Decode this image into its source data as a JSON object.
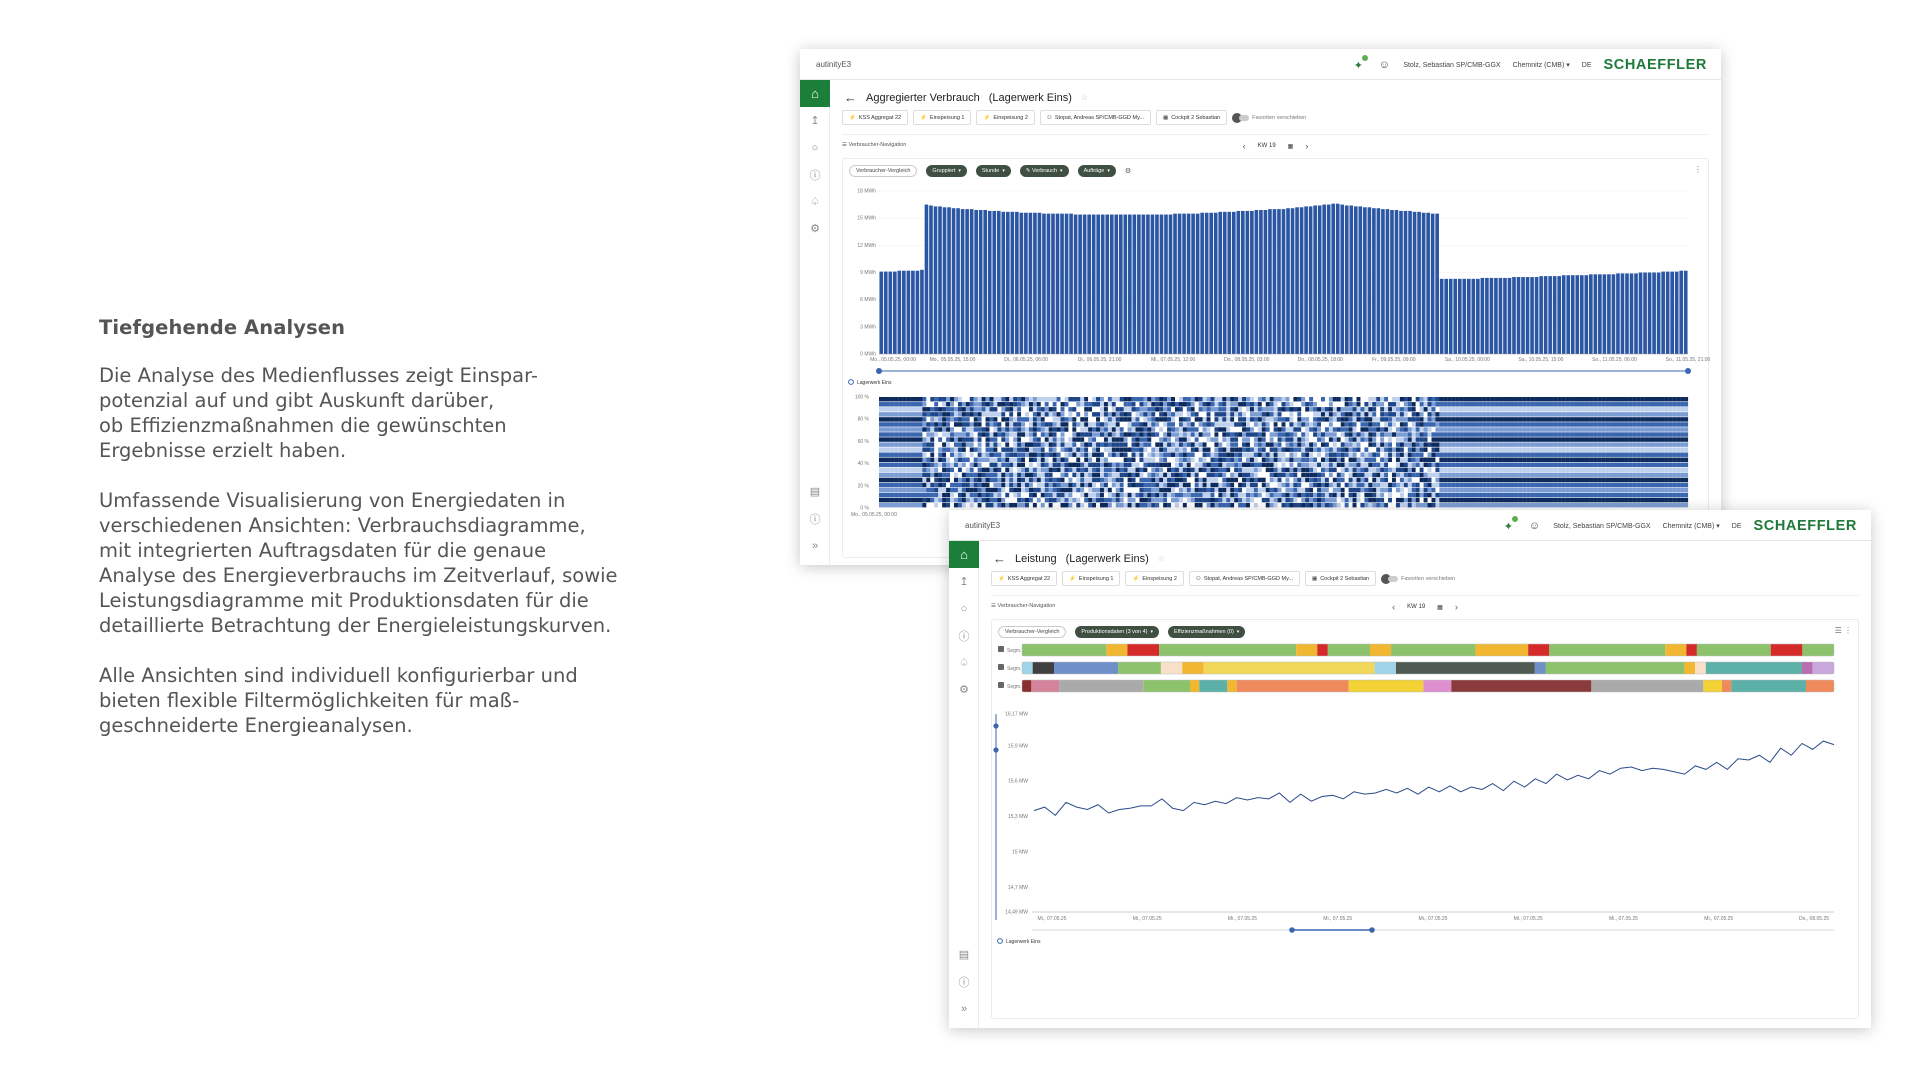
{
  "intro": {
    "heading": "Tiefgehende Analysen",
    "paragraph_1": "Die Analyse des Medienflusses zeigt Einspar-\npotenzial auf und gibt Auskunft darüber,\nob Effizienzmaßnahmen die gewünschten\nErgebnisse erzielt haben.",
    "paragraph_2": "Umfassende Visualisierung von Energiedaten in\nverschiedenen Ansichten: Verbrauchsdiagramme,\nmit integrierten Auftragsdaten für die genaue\nAnalyse des Energieverbrauchs im Zeitverlauf, sowie\nLeistungsdiagramme mit Produktionsdaten für die\ndetaillierte Betrachtung der Energieleistungskurven.",
    "paragraph_3": "Alle Ansichten sind individuell konfigurierbar und\nbieten flexible Filtermöglichkeiten für maß-\ngeschneiderte Energieanalysen."
  },
  "app": {
    "name": "autinityE3",
    "user": "Stolz, Sebastian SP/CMB-GGX",
    "site": "Chemnitz (CMB)",
    "language": "DE",
    "brand": "SCHAEFFLER",
    "brand_color": "#1f7a3a",
    "favorites": [
      {
        "icon": "bolt-icon",
        "label": "KSS Aggregat 22"
      },
      {
        "icon": "bolt-icon",
        "label": "Einspeisung 1"
      },
      {
        "icon": "bolt-icon",
        "label": "Einspeisung 2"
      },
      {
        "icon": "users-icon",
        "label": "Stopat, Andreas SP/CMB-GGD My..."
      },
      {
        "icon": "grid-icon",
        "label": "Cockpit 2 Sebastian"
      }
    ],
    "favorites_edit": "Favoriten verschieben",
    "nav_label": "Verbraucher-Navigation",
    "week": "KW 19"
  },
  "window1": {
    "title": "Aggregierter Verbrauch",
    "subtitle": "(Lagerwerk Eins)",
    "chips": {
      "compare": "Verbraucher-Vergleich",
      "grouped": "Gruppiert",
      "interval": "Stunde",
      "metric": "Verbrauch",
      "orders": "Aufträge"
    },
    "legend": "Lagerwerk Eins",
    "heat_ticks": [
      "100 %",
      "80 %",
      "60 %",
      "40 %",
      "20 %",
      "0 %"
    ],
    "heat_x_ticks": [
      "Mo., 05.05.25, 00:00",
      "Mo., 05..."
    ]
  },
  "window2": {
    "title": "Leistung",
    "subtitle": "(Lagerwerk Eins)",
    "chips": {
      "compare": "Verbraucher-Vergleich",
      "production": "Produktionsdaten (3 von 4)",
      "efficiency": "Effizienzmaßnahmen (0)"
    },
    "segment_label": "Segm...",
    "legend": "Lagerwerk Eins"
  },
  "chart_data": [
    {
      "type": "bar",
      "title": "",
      "xlabel": "",
      "ylabel": "",
      "y_ticks": [
        "0 MWh",
        "3 MWh",
        "6 MWh",
        "9 MWh",
        "12 MWh",
        "15 MWh",
        "18 MWh"
      ],
      "ylim": [
        0,
        18
      ],
      "x_ticks": [
        "Mo., 05.05.25, 00:00",
        "Mo., 05.05.25, 15:00",
        "Di., 06.05.25, 06:00",
        "Di., 06.05.25, 21:00",
        "Mi., 07.05.25, 12:00",
        "Do., 08.05.25, 03:00",
        "Do., 08.05.25, 18:00",
        "Fr., 09.05.25, 09:00",
        "Sa., 10.05.25, 00:00",
        "Sa., 10.05.25, 15:00",
        "So., 11.05.25, 06:00",
        "So., 11.05.25, 21:00"
      ],
      "series": [
        {
          "color": "#2b56a3",
          "values": [
            9.1,
            9.1,
            9.1,
            9.1,
            9.2,
            9.2,
            9.2,
            9.2,
            9.2,
            9.3,
            16.5,
            16.4,
            16.3,
            16.3,
            16.2,
            16.2,
            16.1,
            16.1,
            16.0,
            16.0,
            16.0,
            15.9,
            15.9,
            15.9,
            15.8,
            15.8,
            15.8,
            15.7,
            15.7,
            15.7,
            15.7,
            15.6,
            15.6,
            15.6,
            15.6,
            15.6,
            15.5,
            15.5,
            15.5,
            15.5,
            15.5,
            15.5,
            15.5,
            15.4,
            15.4,
            15.4,
            15.4,
            15.4,
            15.4,
            15.4,
            15.4,
            15.4,
            15.4,
            15.4,
            15.4,
            15.4,
            15.4,
            15.4,
            15.4,
            15.4,
            15.4,
            15.4,
            15.4,
            15.4,
            15.4,
            15.5,
            15.5,
            15.5,
            15.5,
            15.5,
            15.5,
            15.6,
            15.6,
            15.6,
            15.6,
            15.7,
            15.7,
            15.7,
            15.7,
            15.8,
            15.8,
            15.8,
            15.8,
            15.9,
            15.9,
            15.9,
            16.0,
            16.0,
            16.0,
            16.0,
            16.1,
            16.1,
            16.2,
            16.2,
            16.3,
            16.3,
            16.4,
            16.4,
            16.5,
            16.5,
            16.6,
            16.6,
            16.5,
            16.4,
            16.4,
            16.3,
            16.3,
            16.2,
            16.2,
            16.1,
            16.1,
            16.0,
            16.0,
            15.9,
            15.9,
            15.8,
            15.8,
            15.8,
            15.7,
            15.7,
            15.6,
            15.6,
            15.5,
            15.5,
            8.3,
            8.3,
            8.3,
            8.3,
            8.3,
            8.3,
            8.3,
            8.3,
            8.3,
            8.4,
            8.4,
            8.4,
            8.4,
            8.4,
            8.4,
            8.4,
            8.5,
            8.5,
            8.5,
            8.5,
            8.5,
            8.5,
            8.6,
            8.6,
            8.6,
            8.6,
            8.6,
            8.7,
            8.7,
            8.7,
            8.7,
            8.7,
            8.7,
            8.8,
            8.8,
            8.8,
            8.8,
            8.8,
            8.8,
            8.9,
            8.9,
            8.9,
            8.9,
            8.9,
            9.0,
            9.0,
            9.0,
            9.0,
            9.0,
            9.1,
            9.1,
            9.1,
            9.1,
            9.2,
            9.2
          ]
        }
      ]
    },
    {
      "type": "line",
      "title": "",
      "xlabel": "",
      "ylabel": "",
      "y_ticks": [
        "14,49 MW",
        "14,7 MW",
        "15 MW",
        "15,3 MW",
        "15,6 MW",
        "15,9 MW",
        "16,17 MW"
      ],
      "ylim": [
        14.49,
        16.17
      ],
      "x_ticks": [
        "Mi., 07.05.25",
        "Mi., 07.05.25",
        "Mi., 07.05.25",
        "Mi., 07.05.25",
        "Mi., 07.05.25",
        "Mi., 07.05.25",
        "Mi., 07.05.25",
        "Mi., 07.05.25",
        "Do., 08.05.25"
      ],
      "series": [
        {
          "name": "Lagerwerk Eins",
          "color": "#2b4b8c",
          "values": [
            15.35,
            15.38,
            15.31,
            15.42,
            15.38,
            15.36,
            15.4,
            15.33,
            15.36,
            15.37,
            15.39,
            15.39,
            15.45,
            15.37,
            15.35,
            15.42,
            15.4,
            15.43,
            15.41,
            15.46,
            15.44,
            15.46,
            15.45,
            15.5,
            15.42,
            15.49,
            15.43,
            15.47,
            15.48,
            15.45,
            15.51,
            15.49,
            15.5,
            15.53,
            15.5,
            15.54,
            15.49,
            15.55,
            15.51,
            15.56,
            15.51,
            15.55,
            15.53,
            15.58,
            15.52,
            15.6,
            15.55,
            15.62,
            15.58,
            15.66,
            15.61,
            15.65,
            15.62,
            15.69,
            15.66,
            15.71,
            15.72,
            15.69,
            15.71,
            15.7,
            15.68,
            15.66,
            15.73,
            15.7,
            15.76,
            15.7,
            15.79,
            15.78,
            15.82,
            15.76,
            15.88,
            15.82,
            15.92,
            15.87,
            15.94,
            15.91
          ]
        }
      ],
      "segments": [
        {
          "label": "Segm...",
          "colors": [
            "#8cc26b",
            "#f2b731",
            "#d42a2a",
            "#8cc26b",
            "#f2b731",
            "#d42a2a",
            "#8cc26b",
            "#f2b731",
            "#8cc26b",
            "#f2b731",
            "#d42a2a",
            "#8cc26b",
            "#f2b731",
            "#d42a2a",
            "#8cc26b",
            "#d42a2a",
            "#8cc26b"
          ],
          "weights": [
            8,
            2,
            3,
            13,
            2,
            1,
            4,
            2,
            8,
            5,
            2,
            11,
            2,
            1,
            7,
            3,
            3
          ]
        },
        {
          "label": "Segm...",
          "colors": [
            "#9ed3e8",
            "#404040",
            "#6f8fc9",
            "#8cc26b",
            "#f9e0c8",
            "#f2b731",
            "#f2d85a",
            "#9ed3e8",
            "#4f5a52",
            "#6f8fc9",
            "#8cc26b",
            "#f2b731",
            "#f9e0c8",
            "#5bb0a8",
            "#b86db0",
            "#c8a8dc"
          ],
          "weights": [
            1,
            2,
            6,
            4,
            2,
            2,
            16,
            2,
            13,
            1,
            13,
            1,
            1,
            9,
            1,
            2
          ]
        },
        {
          "label": "Segm...",
          "colors": [
            "#8a2d2d",
            "#d4839a",
            "#aaaaaa",
            "#8cc26b",
            "#f2b731",
            "#5bb0a8",
            "#f2b731",
            "#f08a5c",
            "#f2d234",
            "#de8fd0",
            "#8a3a3a",
            "#aaaaaa",
            "#f2d234",
            "#f08a5c",
            "#5bb0a8",
            "#f08a5c"
          ],
          "weights": [
            1,
            3,
            9,
            5,
            1,
            3,
            1,
            12,
            8,
            3,
            15,
            12,
            2,
            1,
            8,
            3
          ]
        }
      ]
    }
  ]
}
